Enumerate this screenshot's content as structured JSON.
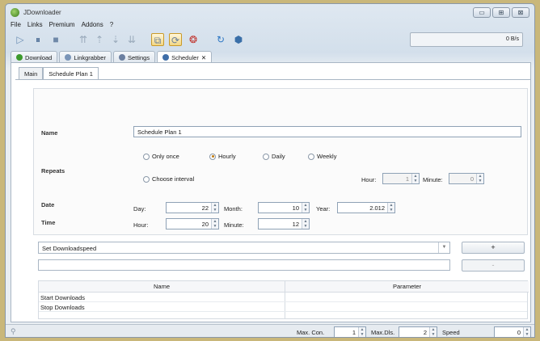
{
  "window": {
    "title": "JDownloader",
    "controls": [
      "▭",
      "⊞",
      "⊠"
    ]
  },
  "menu": [
    "File",
    "Links",
    "Premium",
    "Addons",
    "?"
  ],
  "toolbar": {
    "icons": [
      {
        "name": "play-icon",
        "glyph": "▷"
      },
      {
        "name": "pause-icon",
        "glyph": "⏸"
      },
      {
        "name": "stop-icon",
        "glyph": "■"
      },
      {
        "name": "move-top-icon",
        "glyph": "⇈"
      },
      {
        "name": "move-up-icon",
        "glyph": "⇡"
      },
      {
        "name": "move-down-icon",
        "glyph": "⇣"
      },
      {
        "name": "move-bottom-icon",
        "glyph": "⇊"
      },
      {
        "name": "clipboard-icon",
        "glyph": "⧉"
      },
      {
        "name": "reconnect-icon",
        "glyph": "⟳"
      },
      {
        "name": "premium-icon",
        "glyph": "❂"
      },
      {
        "name": "update-icon",
        "glyph": "↻"
      },
      {
        "name": "plugin-icon",
        "glyph": "⬢"
      }
    ],
    "speed_text": "0 B/s"
  },
  "tabs": [
    {
      "label": "Download",
      "color": "#3d9a2c",
      "active": false
    },
    {
      "label": "Linkgrabber",
      "color": "#7a95b8",
      "active": false
    },
    {
      "label": "Settings",
      "color": "#6b7fa0",
      "active": false
    },
    {
      "label": "Scheduler",
      "color": "#3f6ea8",
      "active": true,
      "close": "✕"
    }
  ],
  "subtabs": [
    {
      "label": "Main",
      "active": false
    },
    {
      "label": "Schedule Plan 1",
      "active": true
    }
  ],
  "form": {
    "name_label": "Name",
    "name_value": "Schedule Plan 1",
    "repeats_label": "Repeats",
    "radio_options": [
      {
        "label": "Only once",
        "checked": false
      },
      {
        "label": "Hourly",
        "checked": true
      },
      {
        "label": "Daily",
        "checked": false
      },
      {
        "label": "Weekly",
        "checked": false
      },
      {
        "label": "Choose interval",
        "checked": false
      }
    ],
    "interval_hour_label": "Hour:",
    "interval_hour_value": "1",
    "interval_minute_label": "Minute:",
    "interval_minute_value": "0",
    "date_label": "Date",
    "day_label": "Day:",
    "day_value": "22",
    "month_label": "Month:",
    "month_value": "10",
    "year_label": "Year:",
    "year_value": "2.012",
    "time_label": "Time",
    "hour_label": "Hour:",
    "hour_value": "20",
    "minute_label": "Minute:",
    "minute_value": "12"
  },
  "action": {
    "select_value": "Set Downloadspeed",
    "add_label": "+",
    "remove_label": "-"
  },
  "table": {
    "headers": [
      "Name",
      "Parameter"
    ],
    "rows": [
      {
        "name": "Start Downloads",
        "parameter": ""
      },
      {
        "name": "Stop Downloads",
        "parameter": ""
      }
    ]
  },
  "statusbar": {
    "max_con_label": "Max. Con.",
    "max_con_value": "1",
    "max_dls_label": "Max.Dls.",
    "max_dls_value": "2",
    "speed_label": "Speed",
    "speed_value": "0"
  }
}
